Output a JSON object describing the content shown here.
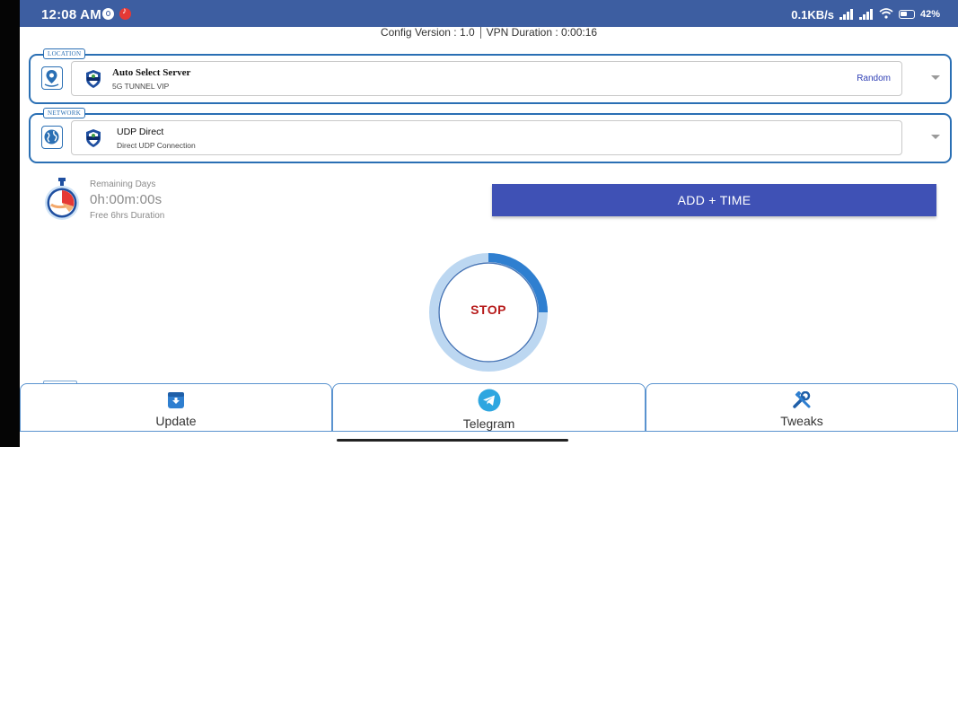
{
  "status_bar": {
    "time": "12:08 AM",
    "net_speed": "0.1KB/s",
    "battery": "42%"
  },
  "config_line": {
    "config_version": "Config Version : 1.0",
    "vpn_duration": "VPN Duration : 0:00:16"
  },
  "location": {
    "tag": "LOCATION",
    "title": "Auto Select Server",
    "subtitle": "5G TUNNEL VIP",
    "mode": "Random"
  },
  "network": {
    "tag": "NETWORK",
    "title": "UDP Direct",
    "subtitle": "Direct UDP Connection"
  },
  "remaining": {
    "label": "Remaining Days",
    "value": "0h:00m:00s",
    "note": "Free 6hrs Duration"
  },
  "add_time_label": "ADD + TIME",
  "connect_button": {
    "label": "STOP",
    "progress": 0.25
  },
  "bottom_nav": [
    {
      "label": "Update",
      "icon": "update-icon"
    },
    {
      "label": "Telegram",
      "icon": "telegram-icon"
    },
    {
      "label": "Tweaks",
      "icon": "tools-icon"
    }
  ],
  "colors": {
    "status_bar": "#3d5ea1",
    "accent": "#2a6fb4",
    "button": "#3f51b5",
    "stop_text": "#b71c1c"
  }
}
